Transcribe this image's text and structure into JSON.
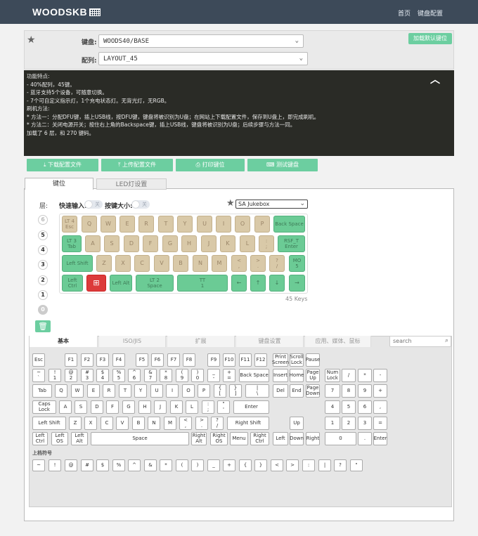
{
  "nav": {
    "logo": "WOODSKB",
    "home": "首页",
    "config": "键盘配置"
  },
  "header": {
    "keyboard_label": "键盘:",
    "keyboard_value": "WOODS40/BASE",
    "layout_label": "配列:",
    "layout_value": "LAYOUT_45",
    "load_default": "加载默认键位"
  },
  "info": {
    "lines": [
      "功能特点:",
      "- 40%配列，45键。",
      "- 蓝牙支持5个设备，可随意切换。",
      "- 7个可自定义指示灯，1个充电状态灯。无背光灯，无RGB。",
      "",
      "刷机方法:",
      "* 方法一：分配DFU键，插上USB线，按DFU键，键盘将被识别为U盘；在网站上下载配置文件，保存到U盘上，即完成刷机。",
      "* 方法二：关闭电源开关；按住右上角的Backspace键，插上USB线，键盘将被识别为U盘；后续步骤与方法一同。",
      "",
      "加载了 6 层，和 270 键码。"
    ]
  },
  "toolbar": {
    "download": "下载配置文件",
    "upload": "上传配置文件",
    "print": "打印键位",
    "test": "测试键盘"
  },
  "tabs": {
    "keymap": "键位",
    "led": "LED灯设置"
  },
  "controls": {
    "layer_label": "层:",
    "quick_input": "快速输入:",
    "toggle_off": "关",
    "key_size": "按键大小:",
    "theme": "SA Jukebox",
    "keys_count": "45 Keys"
  },
  "layers": [
    "6",
    "5",
    "4",
    "3",
    "2",
    "1",
    "0"
  ],
  "lower_tabs": [
    "基本",
    "ISO/JIS",
    "扩展",
    "键盘设置",
    "应用、媒体、鼠标"
  ],
  "search_placeholder": "search",
  "shifted_label": "上档符号",
  "colors": {
    "nav": "#3d4a59",
    "accent": "#6ccea0",
    "key_beige": "#d9c9a8",
    "key_green": "#6bcb95",
    "key_red": "#dc3b3b"
  }
}
